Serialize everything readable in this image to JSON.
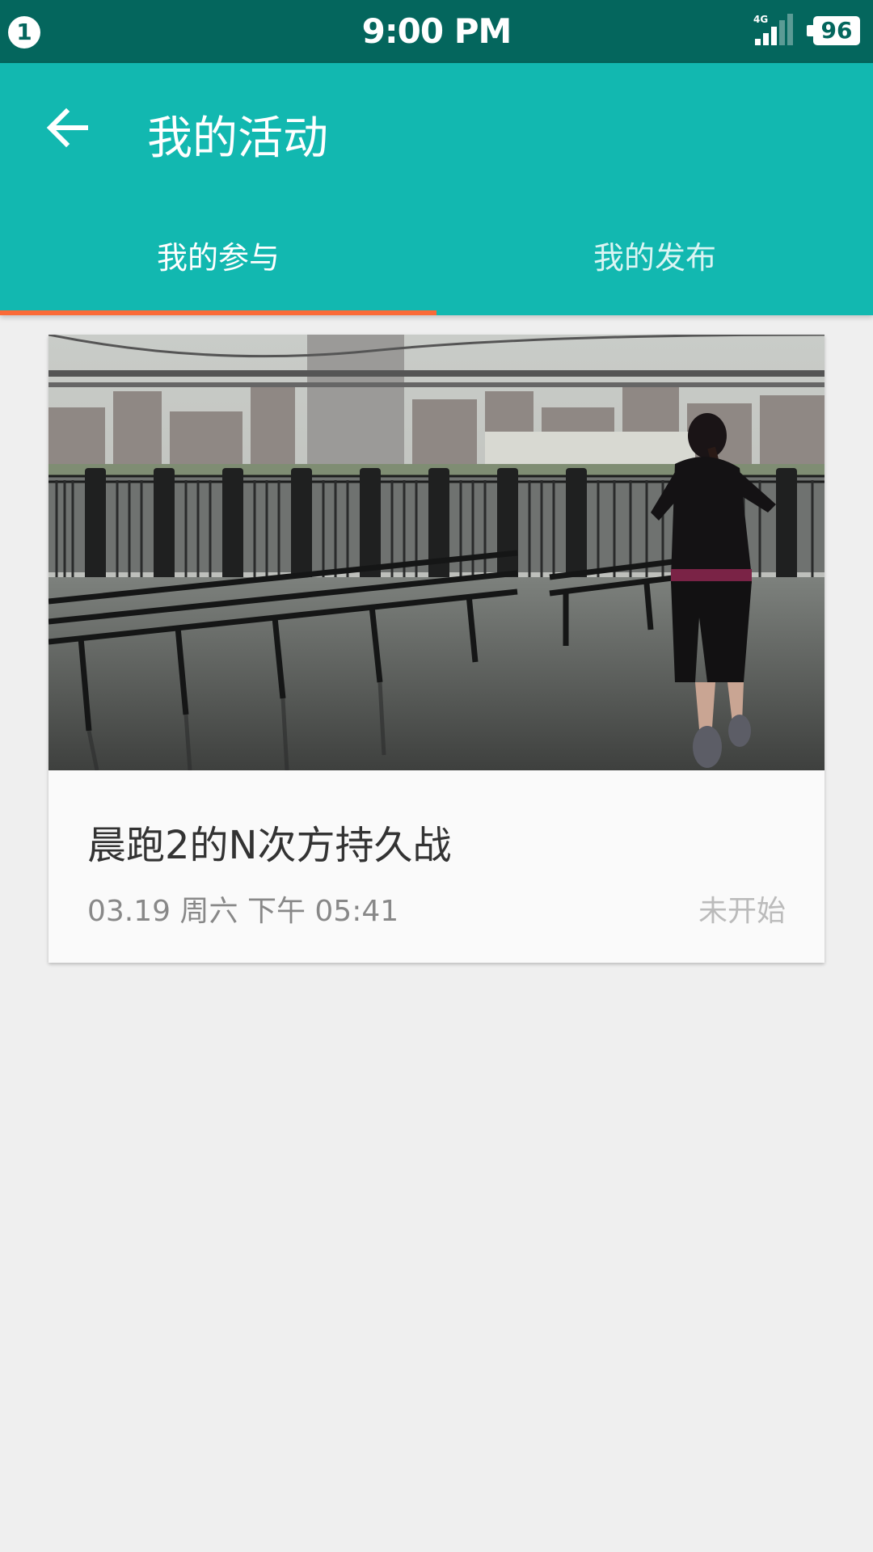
{
  "status_bar": {
    "notification_count": "1",
    "time": "9:00 PM",
    "network": "4G",
    "battery": "96"
  },
  "app_bar": {
    "title": "我的活动",
    "back_icon": "arrow-left-icon"
  },
  "tabs": [
    {
      "label": "我的参与",
      "selected": true
    },
    {
      "label": "我的发布",
      "selected": false
    }
  ],
  "activities": [
    {
      "title": "晨跑2的N次方持久战",
      "datetime": "03.19 周六 下午 05:41",
      "status": "未开始",
      "image": "woman-jogging-by-waterfront-benches"
    }
  ],
  "colors": {
    "status_bar": "#04665d",
    "app_bar": "#12b8b0",
    "tab_indicator": "#fa6a37",
    "background": "#efefef"
  }
}
